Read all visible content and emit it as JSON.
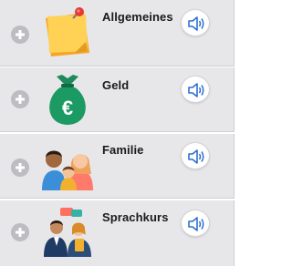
{
  "categories": [
    {
      "label": "Allgemeines",
      "icon": "sticky-note-pin-icon"
    },
    {
      "label": "Geld",
      "icon": "money-bag-euro-icon"
    },
    {
      "label": "Familie",
      "icon": "family-icon"
    },
    {
      "label": "Sprachkurs",
      "icon": "conversation-people-icon"
    }
  ],
  "colors": {
    "row_background": "#e7e7e9",
    "speaker_blue": "#2d6fd1",
    "plus_gray": "#bdbdc1"
  }
}
